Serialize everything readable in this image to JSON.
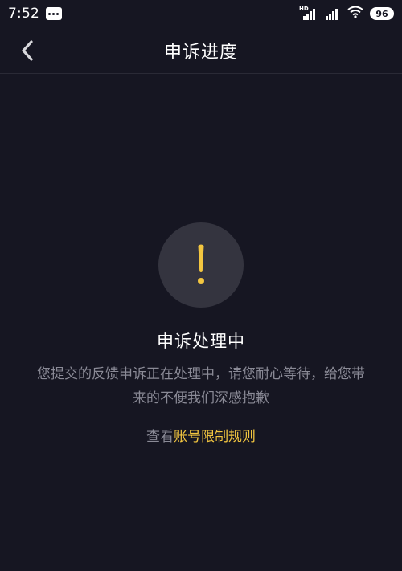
{
  "status_bar": {
    "time": "7:52",
    "hd_label": "HD",
    "battery": "96"
  },
  "nav": {
    "title": "申诉进度"
  },
  "main": {
    "status_title": "申诉处理中",
    "description": "您提交的反馈申诉正在处理中，请您耐心等待，给您带来的不便我们深感抱歉",
    "rules_prefix": "查看",
    "rules_link": "账号限制规则"
  },
  "colors": {
    "background": "#161622",
    "accent": "#f3c640",
    "circle": "#34343f",
    "secondary_text": "#8a8a96"
  },
  "icons": {
    "back": "chevron-left-icon",
    "warning": "exclamation-icon",
    "message": "message-icon",
    "signal": "signal-icon",
    "wifi": "wifi-icon",
    "battery": "battery-icon"
  }
}
